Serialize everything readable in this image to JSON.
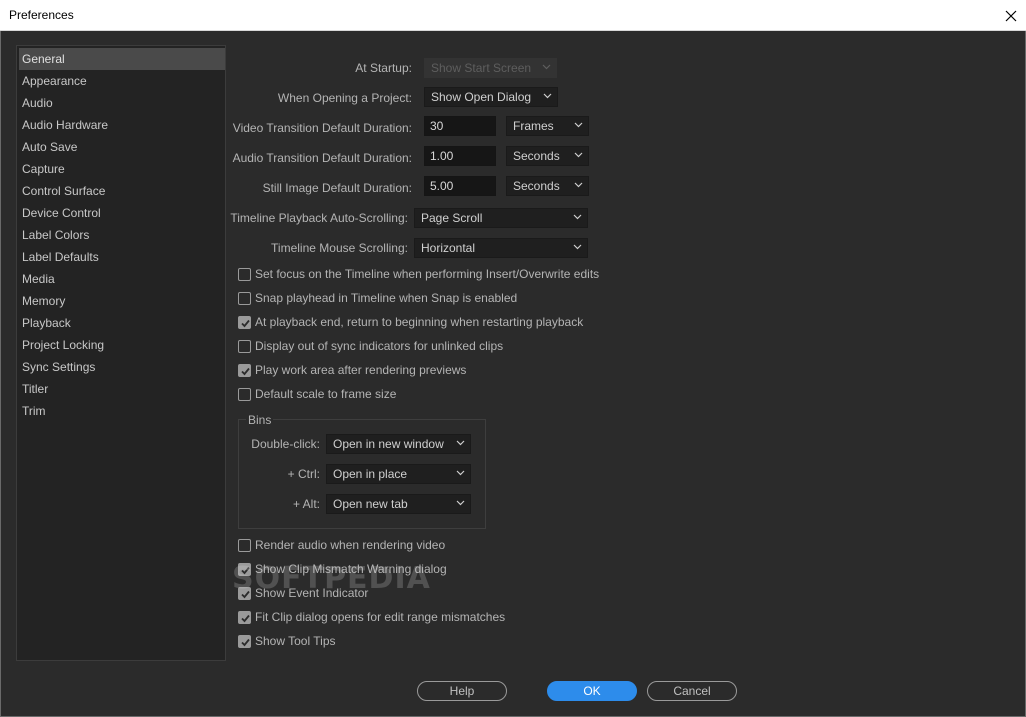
{
  "window": {
    "title": "Preferences"
  },
  "sidebar": {
    "items": [
      {
        "label": "General",
        "selected": true
      },
      {
        "label": "Appearance"
      },
      {
        "label": "Audio"
      },
      {
        "label": "Audio Hardware"
      },
      {
        "label": "Auto Save"
      },
      {
        "label": "Capture"
      },
      {
        "label": "Control Surface"
      },
      {
        "label": "Device Control"
      },
      {
        "label": "Label Colors"
      },
      {
        "label": "Label Defaults"
      },
      {
        "label": "Media"
      },
      {
        "label": "Memory"
      },
      {
        "label": "Playback"
      },
      {
        "label": "Project Locking"
      },
      {
        "label": "Sync Settings"
      },
      {
        "label": "Titler"
      },
      {
        "label": "Trim"
      }
    ]
  },
  "general": {
    "at_startup": {
      "label": "At Startup:",
      "value": "Show Start Screen",
      "disabled": true
    },
    "opening_project": {
      "label": "When Opening a Project:",
      "value": "Show Open Dialog"
    },
    "video_transition": {
      "label": "Video Transition Default Duration:",
      "value": "30",
      "unit": "Frames"
    },
    "audio_transition": {
      "label": "Audio Transition Default Duration:",
      "value": "1.00",
      "unit": "Seconds"
    },
    "still_image": {
      "label": "Still Image Default Duration:",
      "value": "5.00",
      "unit": "Seconds"
    },
    "timeline_autoscroll": {
      "label": "Timeline Playback Auto-Scrolling:",
      "value": "Page Scroll"
    },
    "timeline_mouse": {
      "label": "Timeline Mouse Scrolling:",
      "value": "Horizontal"
    },
    "checks_top": [
      {
        "label": "Set focus on the Timeline when performing Insert/Overwrite edits",
        "checked": false
      },
      {
        "label": "Snap playhead in Timeline when Snap is enabled",
        "checked": false
      },
      {
        "label": "At playback end, return to beginning when restarting playback",
        "checked": true
      },
      {
        "label": "Display out of sync indicators for unlinked clips",
        "checked": false
      },
      {
        "label": "Play work area after rendering previews",
        "checked": true
      },
      {
        "label": "Default scale to frame size",
        "checked": false
      }
    ],
    "bins": {
      "title": "Bins",
      "double_click": {
        "label": "Double-click:",
        "value": "Open in new window"
      },
      "ctrl": {
        "label": "+ Ctrl:",
        "value": "Open in place"
      },
      "alt": {
        "label": "+ Alt:",
        "value": "Open new tab"
      }
    },
    "checks_bottom": [
      {
        "label": "Render audio when rendering video",
        "checked": false
      },
      {
        "label": "Show Clip Mismatch Warning dialog",
        "checked": true
      },
      {
        "label": "Show Event Indicator",
        "checked": true
      },
      {
        "label": "Fit Clip dialog opens for edit range mismatches",
        "checked": true
      },
      {
        "label": "Show Tool Tips",
        "checked": true
      }
    ]
  },
  "buttons": {
    "help": "Help",
    "ok": "OK",
    "cancel": "Cancel"
  },
  "watermark": "SOFTPEDIA",
  "colors": {
    "accent": "#2d8ceb",
    "background": "#2b2b2b",
    "sidebar_selected": "#4a4a4a"
  }
}
